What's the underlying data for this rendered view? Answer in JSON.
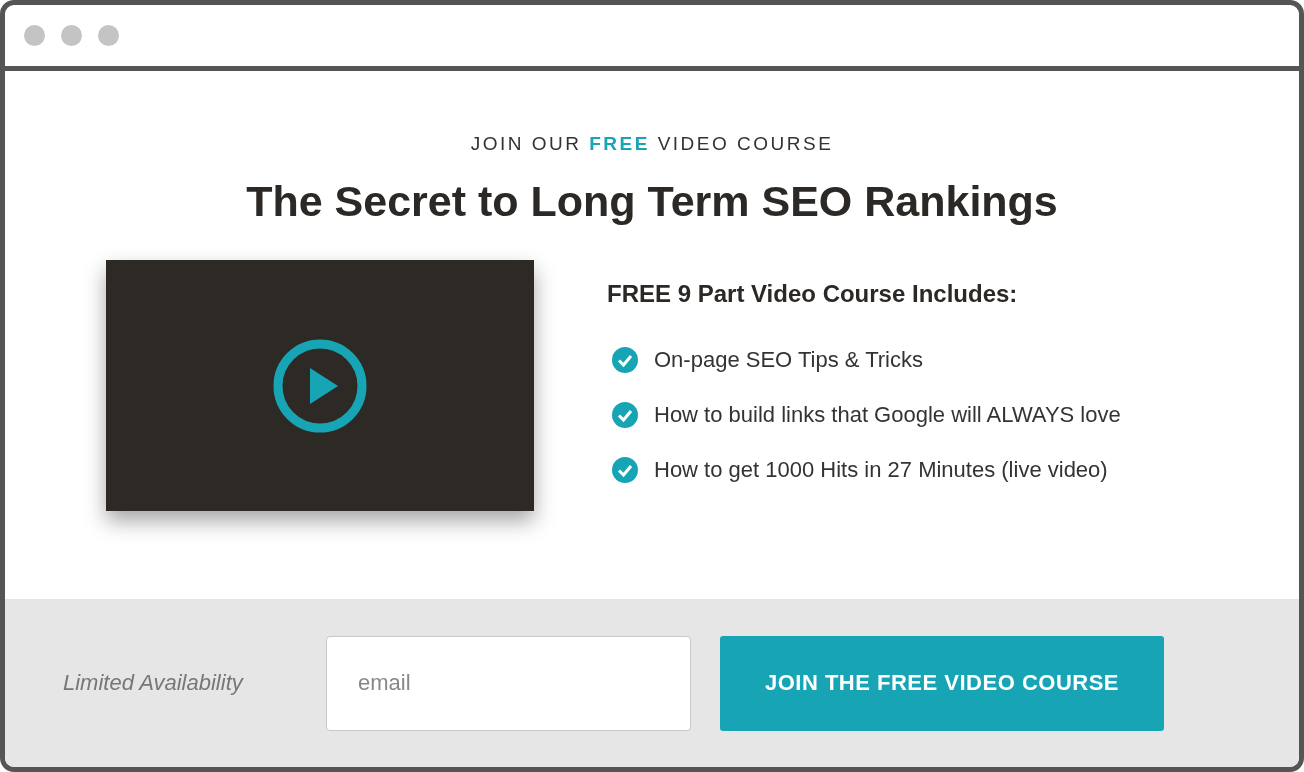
{
  "kicker": "JOIN OUR **FREE** VIDEO COURSE",
  "title": "The Secret to Long Term SEO Rankings",
  "video": {
    "kind": "video"
  },
  "course": {
    "heading": "FREE 9 Part Video Course Includes:",
    "items": [
      {
        "text": "On-page SEO Tips & Tricks",
        "checked": true
      },
      {
        "text": "How to build links that Google will ALWAYS love",
        "checked": true
      },
      {
        "text": "How to get 1000 Hits in 27 Minutes (live video)",
        "checked": true
      }
    ]
  },
  "signup": {
    "note": "Limited Availability",
    "email": {
      "placeholder": "email"
    },
    "button": "JOIN THE FREE VIDEO COURSE"
  }
}
